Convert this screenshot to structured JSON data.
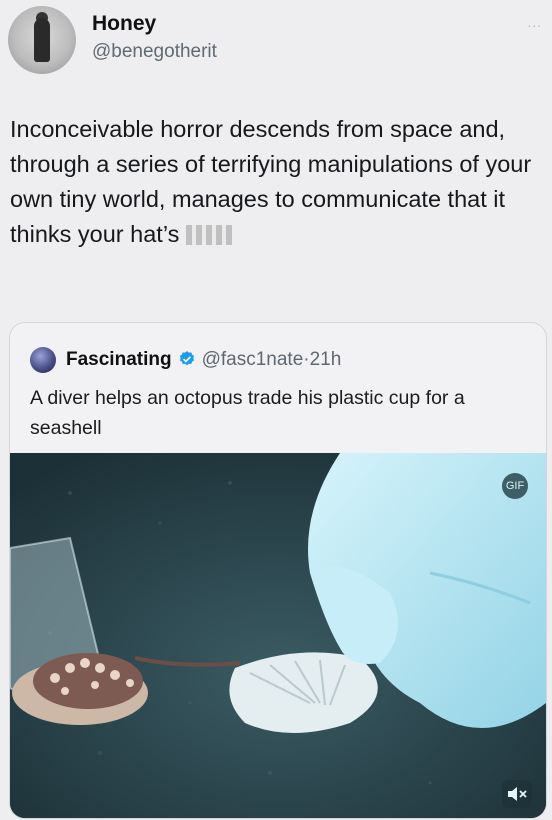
{
  "post": {
    "author_name": "Honey",
    "author_handle": "@benegotherit",
    "text_before_censor": "Inconceivable horror descends from space and, through a series of terrifying manipulations of your own tiny world, manages to communicate that it thinks your hat’s ",
    "more_label": "..."
  },
  "quote": {
    "author_name": "Fascinating",
    "author_handle": "@fasc1nate",
    "separator": "·",
    "time": "21h",
    "text": "A diver helps an octopus trade his plastic cup for a seashell",
    "media": {
      "gif_icon": "GIF",
      "mute_icon": "mute-icon"
    }
  },
  "colors": {
    "verified": "#1d9bf0",
    "water": "#2e4c55",
    "glove": "#bfe9f5"
  }
}
